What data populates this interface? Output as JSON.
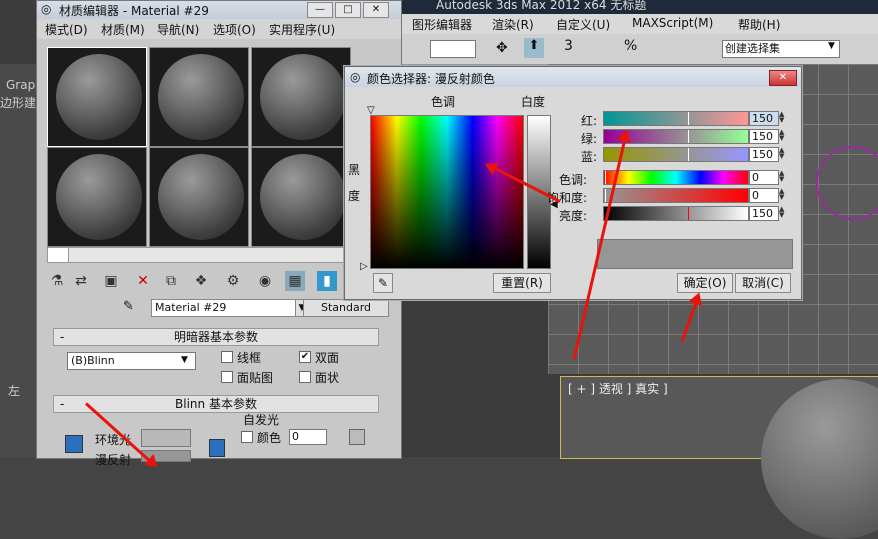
{
  "max": {
    "title": "Autodesk 3ds Max  2012 x64     无标题",
    "menu": [
      "图形编辑器",
      "渲染(R)",
      "自定义(U)",
      "MAXScript(M)",
      "帮助(H)"
    ],
    "selection_set": "创建选择集",
    "toolbar_nums": [
      "3",
      "%"
    ],
    "left_labels": [
      "Grap",
      "边形建",
      "左"
    ],
    "viewport_label": "[ + ] 透视 ] 真实 ]"
  },
  "material_editor": {
    "title": "材质编辑器 - Material #29",
    "menu": [
      "模式(D)",
      "材质(M)",
      "导航(N)",
      "选项(O)",
      "实用程序(U)"
    ],
    "material_name": "Material #29",
    "material_type": "Standard",
    "rollouts": {
      "shader_basic": "明暗器基本参数",
      "blinn_basic": "Blinn 基本参数"
    },
    "shader": "(B)Blinn",
    "checkboxes": [
      {
        "label": "线框",
        "checked": false
      },
      {
        "label": "双面",
        "checked": true
      },
      {
        "label": "面贴图",
        "checked": false
      },
      {
        "label": "面状",
        "checked": false
      }
    ],
    "self_illum": {
      "group": "自发光",
      "label": "颜色",
      "value": "0"
    },
    "ambient_label": "环境光",
    "diffuse_label": "漫反射"
  },
  "color_picker": {
    "title": "颜色选择器: 漫反射颜色",
    "hue_label": "色调",
    "whiteness_label": "白度",
    "blackness_label": "黑\n度",
    "channels": [
      {
        "label": "红:",
        "value": "150"
      },
      {
        "label": "绿:",
        "value": "150"
      },
      {
        "label": "蓝:",
        "value": "150"
      },
      {
        "label": "色调:",
        "value": "0"
      },
      {
        "label": "饱和度:",
        "value": "0"
      },
      {
        "label": "亮度:",
        "value": "150"
      }
    ],
    "reset_button": "重置(R)",
    "ok_button": "确定(O)",
    "cancel_button": "取消(C)",
    "swatch_color": "#969696"
  },
  "annotation_color": "#e8140c"
}
